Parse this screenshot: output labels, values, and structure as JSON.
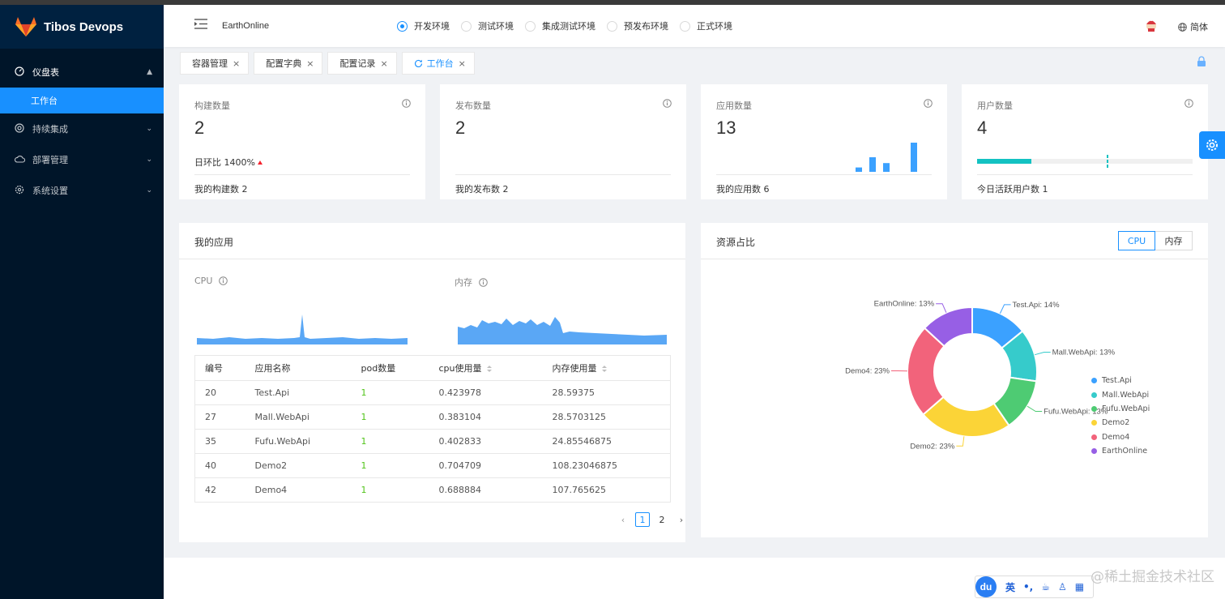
{
  "app": {
    "name": "Tibos Devops"
  },
  "sidebar": {
    "items": [
      {
        "label": "仪盘表",
        "icon": "dashboard-icon",
        "open": true,
        "children": [
          {
            "label": "工作台",
            "active": true
          }
        ]
      },
      {
        "label": "持续集成",
        "icon": "integration-icon"
      },
      {
        "label": "部署管理",
        "icon": "cloud-icon"
      },
      {
        "label": "系统设置",
        "icon": "gear-icon"
      }
    ]
  },
  "header": {
    "project": "EarthOnline",
    "environments": [
      {
        "label": "开发环境",
        "checked": true
      },
      {
        "label": "测试环境",
        "checked": false
      },
      {
        "label": "集成测试环境",
        "checked": false
      },
      {
        "label": "预发布环境",
        "checked": false
      },
      {
        "label": "正式环境",
        "checked": false
      }
    ],
    "language": "简体"
  },
  "tabs": [
    {
      "label": "容器管理"
    },
    {
      "label": "配置字典"
    },
    {
      "label": "配置记录"
    },
    {
      "label": "工作台",
      "active": true
    }
  ],
  "stats": [
    {
      "title": "构建数量",
      "value": "2",
      "trend_label": "日环比",
      "trend_value": "1400%",
      "footer": "我的构建数 2"
    },
    {
      "title": "发布数量",
      "value": "2",
      "footer": "我的发布数 2"
    },
    {
      "title": "应用数量",
      "value": "13",
      "footer": "我的应用数 6",
      "mini_bars": [
        0.15,
        0.5,
        0.3,
        1.0
      ]
    },
    {
      "title": "用户数量",
      "value": "4",
      "footer": "今日活跃用户数 1",
      "progress": 0.25,
      "target": 0.6
    }
  ],
  "my_apps": {
    "title": "我的应用",
    "cpu_label": "CPU",
    "mem_label": "内存",
    "columns": [
      "编号",
      "应用名称",
      "pod数量",
      "cpu使用量",
      "内存使用量"
    ],
    "rows": [
      [
        "20",
        "Test.Api",
        "1",
        "0.423978",
        "28.59375"
      ],
      [
        "27",
        "Mall.WebApi",
        "1",
        "0.383104",
        "28.5703125"
      ],
      [
        "35",
        "Fufu.WebApi",
        "1",
        "0.402833",
        "24.85546875"
      ],
      [
        "40",
        "Demo2",
        "1",
        "0.704709",
        "108.23046875"
      ],
      [
        "42",
        "Demo4",
        "1",
        "0.688884",
        "107.765625"
      ]
    ],
    "pages": [
      "1",
      "2"
    ],
    "current_page": "1"
  },
  "resource": {
    "title": "资源占比",
    "toggle": [
      "CPU",
      "内存"
    ],
    "toggle_selected": "CPU"
  },
  "chart_data": {
    "type": "pie",
    "donut": true,
    "legend": "right",
    "categories": [
      "Test.Api",
      "Mall.WebApi",
      "Fufu.WebApi",
      "Demo2",
      "Demo4",
      "EarthOnline"
    ],
    "values": [
      14,
      13,
      13,
      23,
      23,
      13
    ],
    "labels": [
      "Test.Api: 14%",
      "Mall.WebApi: 13%",
      "Fufu.WebApi: 13%",
      "Demo2: 23%",
      "Demo4: 23%",
      "EarthOnline: 13%"
    ],
    "colors": [
      "#3ba1ff",
      "#36cbcb",
      "#4ecb73",
      "#fbd437",
      "#f2637b",
      "#975fe5"
    ]
  },
  "ime": {
    "mode": "英"
  },
  "watermark": "@稀土掘金技术社区"
}
